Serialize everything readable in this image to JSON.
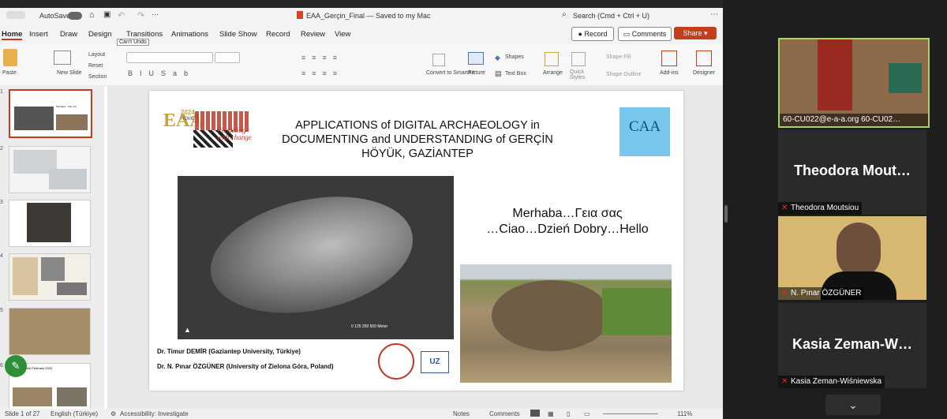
{
  "titlebar": {
    "autosave": "AutoSave",
    "filename": "EAA_Gerçin_Final — Saved to my Mac",
    "search": "Search (Cmd + Ctrl + U)",
    "tooltip": "Can't Undo"
  },
  "tabs": [
    "Home",
    "Insert",
    "Draw",
    "Design",
    "Transitions",
    "Animations",
    "Slide Show",
    "Record",
    "Review",
    "View"
  ],
  "ribbon_buttons": {
    "record": "Record",
    "comments": "Comments",
    "share": "Share"
  },
  "ribbon": {
    "paste": "Paste",
    "new_slide": "New\nSlide",
    "layout": "Layout",
    "reset": "Reset",
    "section": "Section",
    "convert": "Convert to SmartArt",
    "picture": "Picture",
    "shapes": "Shapes",
    "textbox": "Text Box",
    "arrange": "Arrange",
    "quick_styles": "Quick Styles",
    "shape_fill": "Shape Fill",
    "shape_outline": "Shape Outline",
    "addins": "Add-ins",
    "designer": "Designer"
  },
  "slide": {
    "title_line1": "APPLICATIONS of DIGITAL ARCHAEOLOGY in",
    "title_line2": "DOCUMENTING and UNDERSTANDING of GERÇİN",
    "title_line3": "HÖYÜK, GAZİANTEP",
    "greeting_line1": "Merhaba…Γεια σας",
    "greeting_line2": "…Ciao…Dzień Dobry…Hello",
    "author1": "Dr. Timur DEMİR (Gaziantep University, Türkiye)",
    "author2": "Dr. N. Pınar ÖZGÜNER (University of Zielona Góra, Poland)",
    "eaa_logo": {
      "eaa": "EAA",
      "year": "2024",
      "city": "ROME",
      "tagline": "Persisting with change"
    },
    "caa_logo": "CAA",
    "scale": "0   125   250       500 Meter"
  },
  "thumbnails": [
    {
      "num": "1",
      "text": "Merhaba…Γεια σας"
    },
    {
      "num": "2",
      "text": ""
    },
    {
      "num": "3",
      "text": ""
    },
    {
      "num": "4",
      "text": ""
    },
    {
      "num": "5",
      "text": ""
    },
    {
      "num": "6",
      "text": "…and the 6th February 2023"
    }
  ],
  "status": {
    "slide": "Slide 1 of 27",
    "language": "English (Türkiye)",
    "accessibility": "Accessibility: Investigate",
    "notes": "Notes",
    "comments": "Comments",
    "zoom": "111%"
  },
  "participants": [
    {
      "label": "60-CU022@e-a-a.org 60-CU02…",
      "big": ""
    },
    {
      "label": "Theodora Moutsiou",
      "big": "Theodora Mout…"
    },
    {
      "label": "N. Pınar ÖZGÜNER",
      "big": ""
    },
    {
      "label": "Kasia Zeman-Wiśniewska",
      "big": "Kasia Zeman-W…"
    }
  ]
}
